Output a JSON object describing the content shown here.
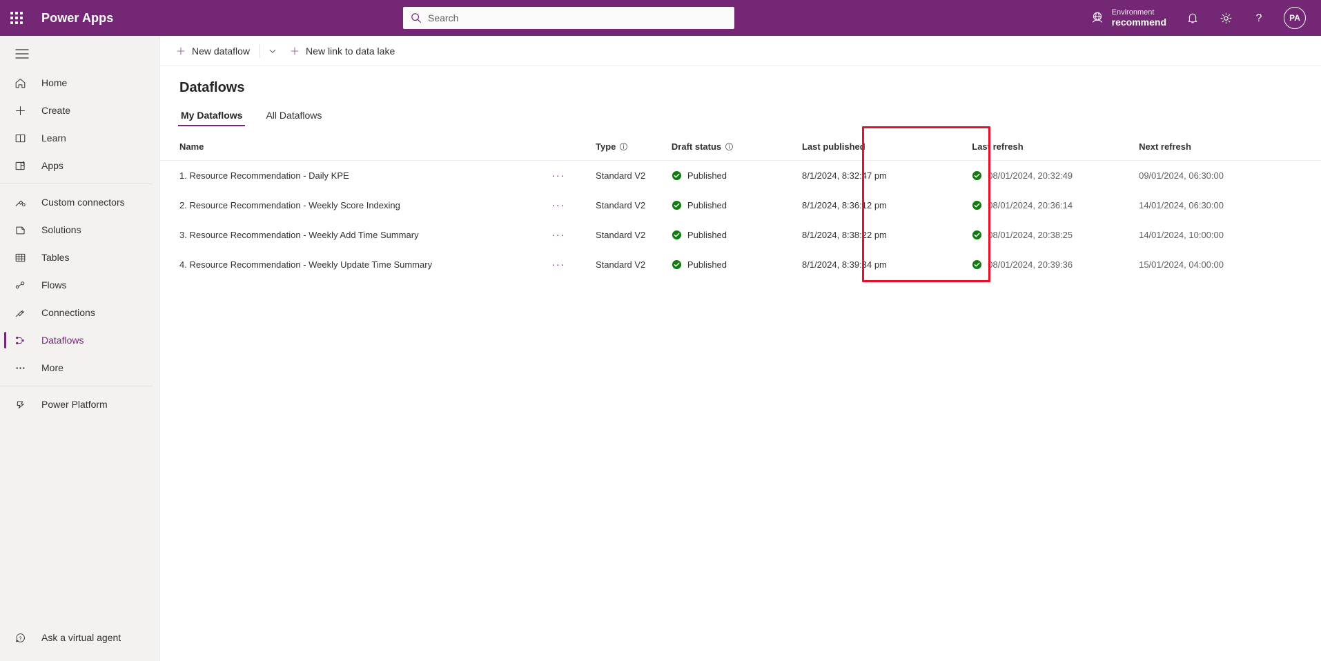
{
  "header": {
    "waffle_label": "app-launcher",
    "brand": "Power Apps",
    "search_placeholder": "Search",
    "search_value": "",
    "environment_label": "Environment",
    "environment_name": "recommend",
    "avatar_initials": "PA"
  },
  "sidebar": {
    "items": [
      {
        "label": "Home",
        "icon": "home-icon",
        "selected": false
      },
      {
        "label": "Create",
        "icon": "plus-icon",
        "selected": false
      },
      {
        "label": "Learn",
        "icon": "book-icon",
        "selected": false
      },
      {
        "label": "Apps",
        "icon": "apps-icon",
        "selected": false
      },
      {
        "label": "Custom connectors",
        "icon": "custom-connector-icon",
        "selected": false
      },
      {
        "label": "Solutions",
        "icon": "solutions-icon",
        "selected": false
      },
      {
        "label": "Tables",
        "icon": "table-icon",
        "selected": false
      },
      {
        "label": "Flows",
        "icon": "flows-icon",
        "selected": false
      },
      {
        "label": "Connections",
        "icon": "connections-icon",
        "selected": false
      },
      {
        "label": "Dataflows",
        "icon": "dataflows-icon",
        "selected": true
      },
      {
        "label": "More",
        "icon": "more-ellipsis-icon",
        "selected": false
      },
      {
        "label": "Power Platform",
        "icon": "power-platform-icon",
        "selected": false
      }
    ],
    "bottom": {
      "label": "Ask a virtual agent",
      "icon": "question-chat-icon"
    }
  },
  "commandbar": {
    "new_dataflow": "New dataflow",
    "new_link_to_data_lake": "New link to data lake"
  },
  "page": {
    "title": "Dataflows",
    "tabs": [
      {
        "label": "My Dataflows",
        "active": true
      },
      {
        "label": "All Dataflows",
        "active": false
      }
    ]
  },
  "table": {
    "columns": [
      {
        "key": "name",
        "label": "Name",
        "info": false
      },
      {
        "key": "type",
        "label": "Type",
        "info": true
      },
      {
        "key": "draft_status",
        "label": "Draft status",
        "info": true
      },
      {
        "key": "last_published",
        "label": "Last published",
        "info": false
      },
      {
        "key": "last_refresh",
        "label": "Last refresh",
        "info": false
      },
      {
        "key": "next_refresh",
        "label": "Next refresh",
        "info": false
      }
    ],
    "rows": [
      {
        "name": "1. Resource Recommendation - Daily KPE",
        "type": "Standard V2",
        "draft_status": "Published",
        "last_published": "8/1/2024, 8:32:47 pm",
        "last_refresh": "08/01/2024, 20:32:49",
        "next_refresh": "09/01/2024, 06:30:00"
      },
      {
        "name": "2. Resource Recommendation - Weekly Score Indexing",
        "type": "Standard V2",
        "draft_status": "Published",
        "last_published": "8/1/2024, 8:36:12 pm",
        "last_refresh": "08/01/2024, 20:36:14",
        "next_refresh": "14/01/2024, 06:30:00"
      },
      {
        "name": "3. Resource Recommendation - Weekly Add Time Summary",
        "type": "Standard V2",
        "draft_status": "Published",
        "last_published": "8/1/2024, 8:38:22 pm",
        "last_refresh": "08/01/2024, 20:38:25",
        "next_refresh": "14/01/2024, 10:00:00"
      },
      {
        "name": "4. Resource Recommendation - Weekly Update Time Summary",
        "type": "Standard V2",
        "draft_status": "Published",
        "last_published": "8/1/2024, 8:39:34 pm",
        "last_refresh": "08/01/2024, 20:39:36",
        "next_refresh": "15/01/2024, 04:00:00"
      }
    ],
    "row_menu_glyph": "···"
  },
  "annotation": {
    "shape": "rectangle",
    "color": "#e8112d",
    "target_column": "Last refresh"
  },
  "colors": {
    "brand_purple": "#742774",
    "accent_purple": "#742774",
    "status_green": "#107c10",
    "annotation_red": "#e8112d",
    "sidebar_bg": "#f3f2f1"
  }
}
